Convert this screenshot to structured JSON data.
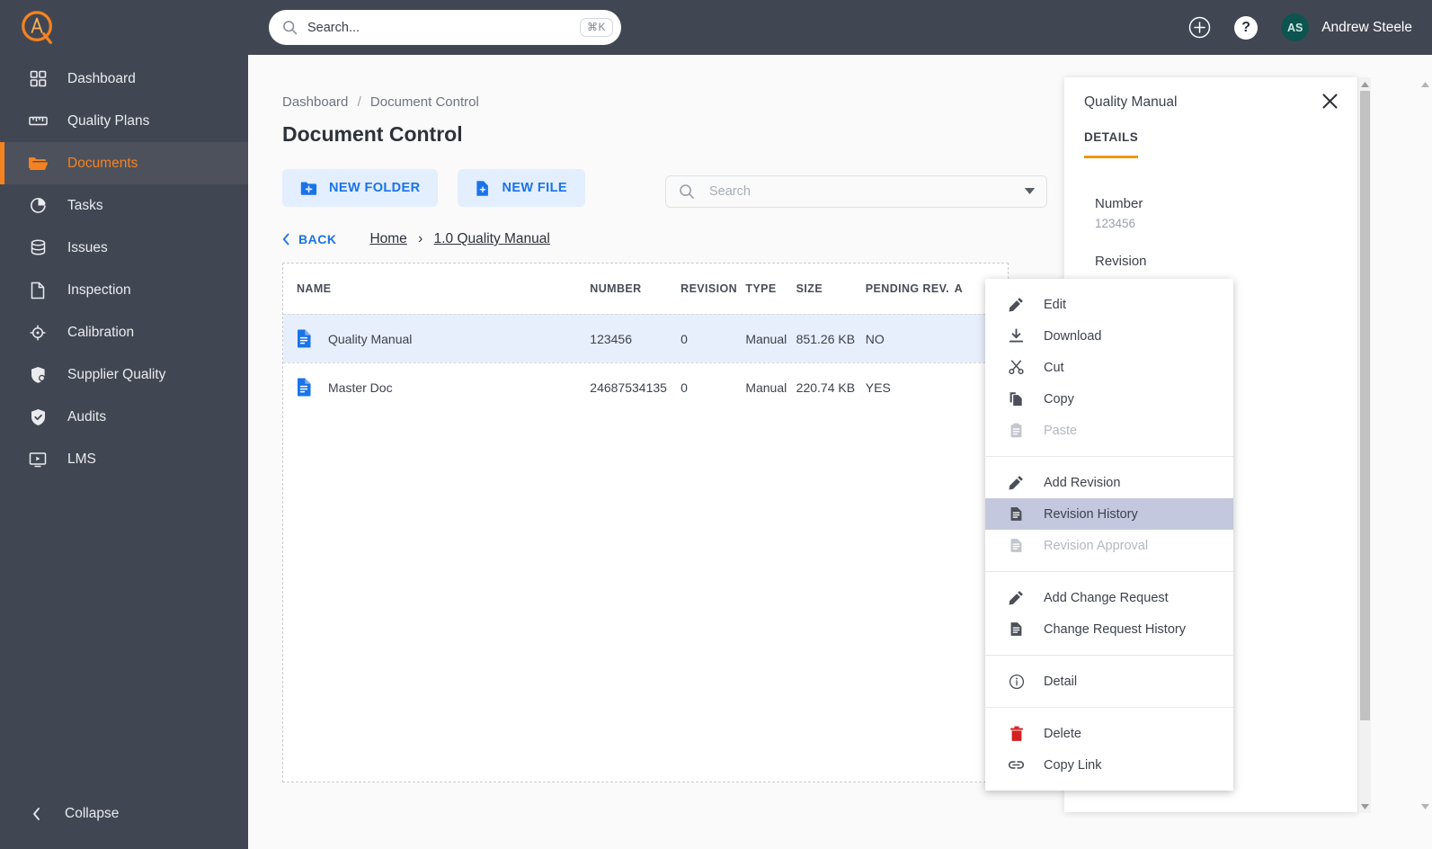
{
  "app": {
    "logo_name": "appq-logo",
    "accent_orange": "#f58220",
    "accent_blue": "#1a73e8",
    "sidebar_bg": "#414752"
  },
  "sidebar": {
    "items": [
      {
        "label": "Dashboard",
        "icon": "grid-icon",
        "active": false
      },
      {
        "label": "Quality Plans",
        "icon": "ruler-icon",
        "active": false
      },
      {
        "label": "Documents",
        "icon": "folder-icon",
        "active": true
      },
      {
        "label": "Tasks",
        "icon": "pie-clock-icon",
        "active": false
      },
      {
        "label": "Issues",
        "icon": "database-icon",
        "active": false
      },
      {
        "label": "Inspection",
        "icon": "page-icon",
        "active": false
      },
      {
        "label": "Calibration",
        "icon": "crosshair-icon",
        "active": false
      },
      {
        "label": "Supplier Quality",
        "icon": "shield-badge-icon",
        "active": false
      },
      {
        "label": "Audits",
        "icon": "shield-check-icon",
        "active": false
      },
      {
        "label": "LMS",
        "icon": "monitor-play-icon",
        "active": false
      }
    ],
    "collapse_label": "Collapse"
  },
  "topbar": {
    "search_placeholder": "Search...",
    "search_value": "",
    "search_shortcut": "⌘K",
    "add_icon": "plus-circle-icon",
    "help_icon": "question-mark-icon",
    "help_glyph": "?",
    "avatar_initials": "AS",
    "user_name": "Andrew Steele"
  },
  "breadcrumb": {
    "root": "Dashboard",
    "separator": "/",
    "current": "Document Control"
  },
  "page": {
    "title": "Document Control"
  },
  "toolbar": {
    "new_folder_label": "NEW FOLDER",
    "new_file_label": "NEW FILE",
    "search_placeholder": "Search",
    "search_value": ""
  },
  "folder_nav": {
    "back_label": "BACK",
    "home_label": "Home",
    "arrow": "›",
    "current_folder": "1.0 Quality Manual",
    "info_icon": "info-circle-icon"
  },
  "table": {
    "columns": [
      "NAME",
      "NUMBER",
      "REVISION",
      "TYPE",
      "SIZE",
      "PENDING REV.",
      "A"
    ],
    "rows": [
      {
        "name": "Quality Manual",
        "number": "123456",
        "revision": "0",
        "type": "Manual",
        "size": "851.26 KB",
        "pending_rev": "NO",
        "approved": "",
        "selected": true
      },
      {
        "name": "Master Doc",
        "number": "24687534135",
        "revision": "0",
        "type": "Manual",
        "size": "220.74 KB",
        "pending_rev": "YES",
        "approved": "",
        "selected": false
      }
    ]
  },
  "context_menu": {
    "groups": [
      {
        "items": [
          {
            "label": "Edit",
            "icon": "pencil-icon",
            "disabled": false,
            "highlighted": false
          },
          {
            "label": "Download",
            "icon": "download-icon",
            "disabled": false,
            "highlighted": false
          },
          {
            "label": "Cut",
            "icon": "scissors-icon",
            "disabled": false,
            "highlighted": false
          },
          {
            "label": "Copy",
            "icon": "copy-icon",
            "disabled": false,
            "highlighted": false
          },
          {
            "label": "Paste",
            "icon": "clipboard-icon",
            "disabled": true,
            "highlighted": false
          }
        ]
      },
      {
        "items": [
          {
            "label": "Add Revision",
            "icon": "pencil-icon",
            "disabled": false,
            "highlighted": false
          },
          {
            "label": "Revision History",
            "icon": "document-lines-icon",
            "disabled": false,
            "highlighted": true
          },
          {
            "label": "Revision Approval",
            "icon": "document-lines-icon",
            "disabled": true,
            "highlighted": false
          }
        ]
      },
      {
        "items": [
          {
            "label": "Add Change Request",
            "icon": "pencil-icon",
            "disabled": false,
            "highlighted": false
          },
          {
            "label": "Change Request History",
            "icon": "document-lines-icon",
            "disabled": false,
            "highlighted": false
          }
        ]
      },
      {
        "items": [
          {
            "label": "Detail",
            "icon": "info-circle-icon",
            "disabled": false,
            "highlighted": false
          }
        ]
      },
      {
        "items": [
          {
            "label": "Delete",
            "icon": "trash-icon",
            "disabled": false,
            "highlighted": false
          },
          {
            "label": "Copy Link",
            "icon": "link-icon",
            "disabled": false,
            "highlighted": false
          }
        ]
      }
    ]
  },
  "details_panel": {
    "title": "Quality Manual",
    "close_icon": "close-icon",
    "tab_label": "DETAILS",
    "fields": [
      {
        "label": "Number",
        "value": "123456"
      },
      {
        "label": "Revision",
        "value": ""
      }
    ]
  }
}
